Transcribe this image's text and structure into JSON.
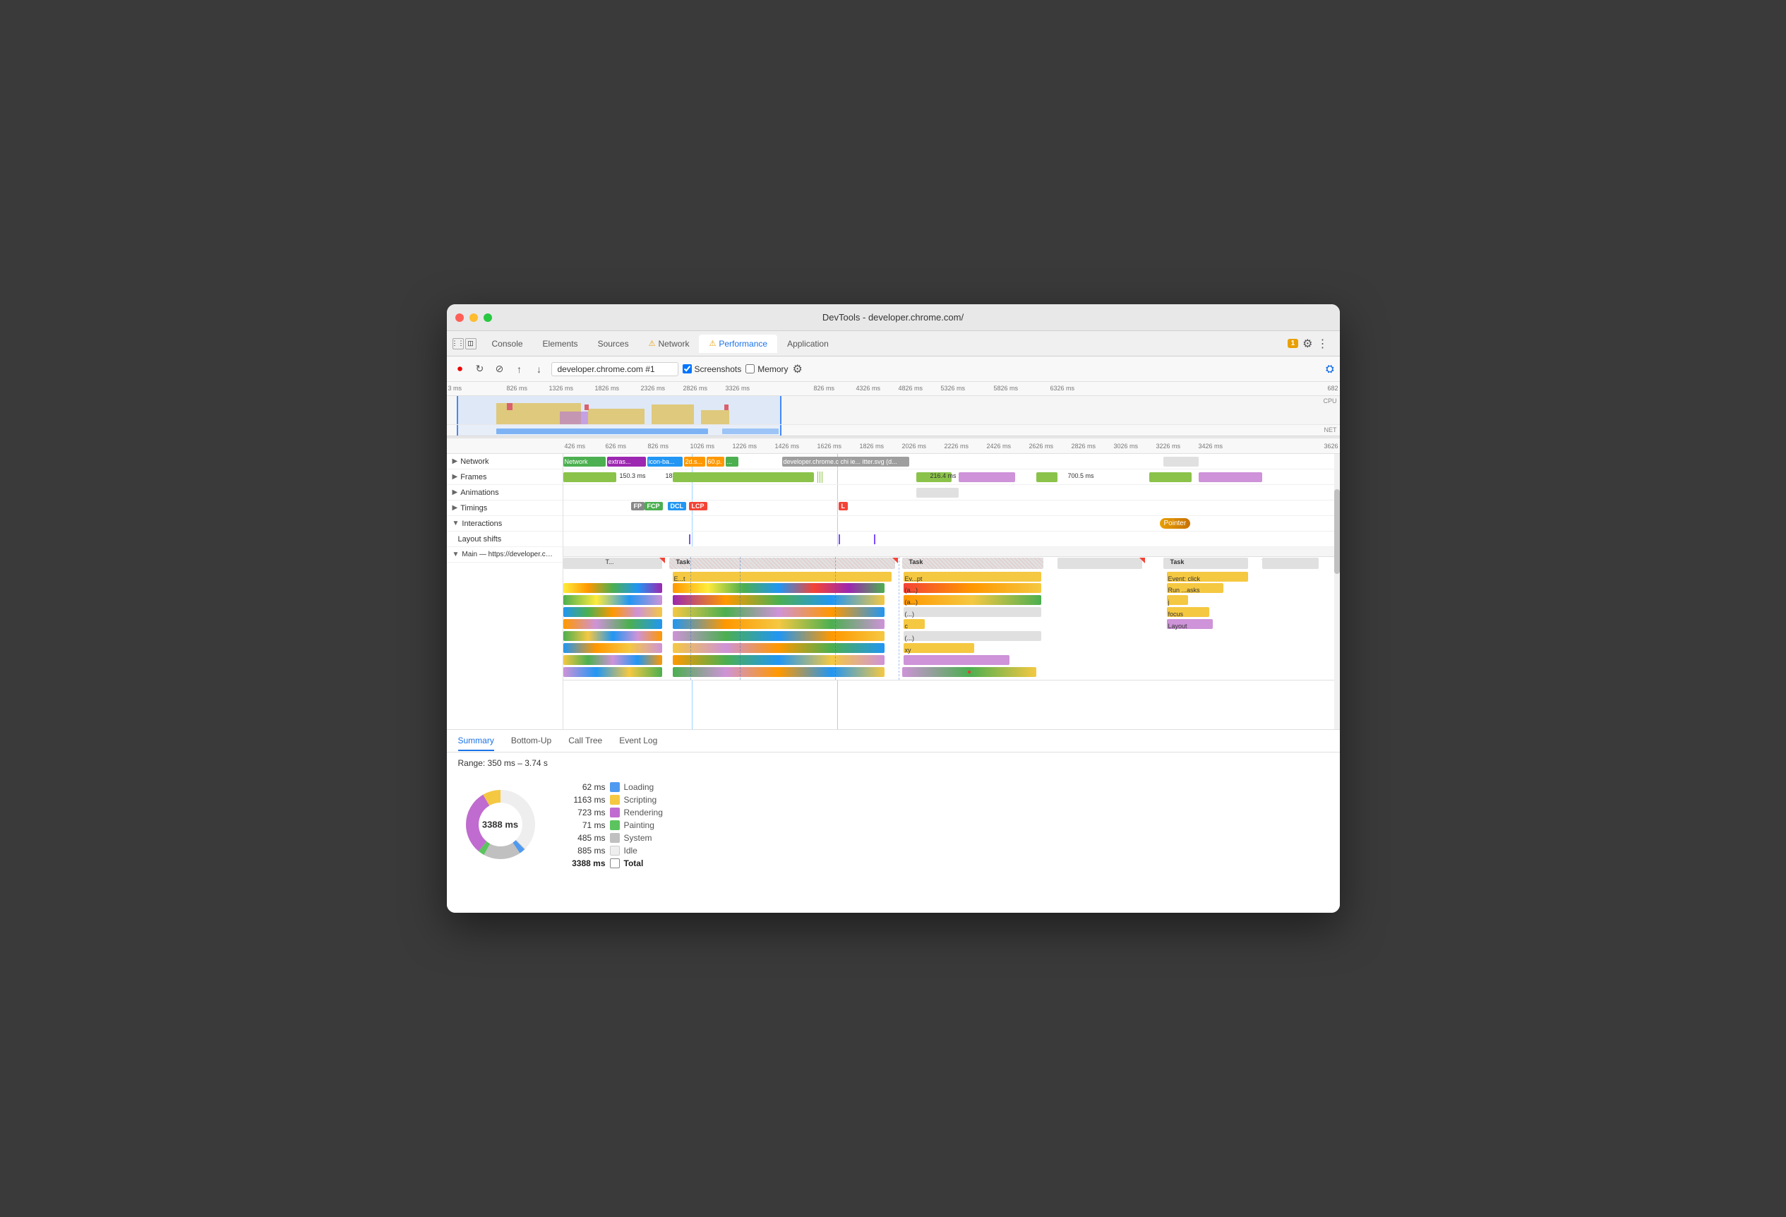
{
  "window": {
    "title": "DevTools - developer.chrome.com/"
  },
  "tabs": [
    {
      "id": "console",
      "label": "Console",
      "active": false,
      "warn": false
    },
    {
      "id": "elements",
      "label": "Elements",
      "active": false,
      "warn": false
    },
    {
      "id": "sources",
      "label": "Sources",
      "active": false,
      "warn": false
    },
    {
      "id": "network",
      "label": "Network",
      "active": false,
      "warn": true
    },
    {
      "id": "performance",
      "label": "Performance",
      "active": true,
      "warn": true
    },
    {
      "id": "application",
      "label": "Application",
      "active": false,
      "warn": false
    }
  ],
  "toolbar": {
    "url": "developer.chrome.com #1",
    "screenshots_label": "Screenshots",
    "memory_label": "Memory"
  },
  "ruler": {
    "ticks": [
      "3 ms",
      "426 ms",
      "626 ms",
      "826 ms",
      "1026 ms",
      "1226 ms",
      "1426 ms",
      "1626 ms",
      "1826 ms",
      "2026 ms",
      "2226 ms",
      "2426 ms",
      "2626 ms",
      "2826 ms",
      "3026 ms",
      "3226 ms",
      "3426 ms",
      "3626"
    ]
  },
  "overview_ruler": {
    "ticks": [
      "826 ms",
      "1326 ms",
      "1826 ms",
      "2326 ms",
      "2826 ms",
      "3326 ms",
      "826 ms",
      "4326 ms",
      "4826 ms",
      "5326 ms",
      "5826 ms",
      "6326 ms",
      "682"
    ]
  },
  "left_panel": {
    "rows": [
      {
        "id": "network",
        "label": "Network",
        "indent": 0,
        "has_arrow": true,
        "expanded": true
      },
      {
        "id": "frames",
        "label": "Frames",
        "indent": 0,
        "has_arrow": true,
        "expanded": false
      },
      {
        "id": "animations",
        "label": "Animations",
        "indent": 0,
        "has_arrow": true,
        "expanded": false
      },
      {
        "id": "timings",
        "label": "Timings",
        "indent": 0,
        "has_arrow": true,
        "expanded": false
      },
      {
        "id": "interactions",
        "label": "Interactions",
        "indent": 0,
        "has_arrow": true,
        "expanded": true
      },
      {
        "id": "layout_shifts",
        "label": "Layout shifts",
        "indent": 0,
        "has_arrow": false,
        "expanded": false
      },
      {
        "id": "main",
        "label": "Main — https://developer.chrome.com/",
        "indent": 0,
        "has_arrow": true,
        "expanded": true
      }
    ]
  },
  "bottom_tabs": {
    "tabs": [
      {
        "id": "summary",
        "label": "Summary",
        "active": true
      },
      {
        "id": "bottom-up",
        "label": "Bottom-Up",
        "active": false
      },
      {
        "id": "call-tree",
        "label": "Call Tree",
        "active": false
      },
      {
        "id": "event-log",
        "label": "Event Log",
        "active": false
      }
    ]
  },
  "summary": {
    "range": "Range: 350 ms – 3.74 s",
    "total_ms": "3388 ms",
    "items": [
      {
        "id": "loading",
        "value": "62 ms",
        "label": "Loading",
        "color": "#4e9af1"
      },
      {
        "id": "scripting",
        "value": "1163 ms",
        "label": "Scripting",
        "color": "#f5c842"
      },
      {
        "id": "rendering",
        "value": "723 ms",
        "label": "Rendering",
        "color": "#c06bcf"
      },
      {
        "id": "painting",
        "value": "71 ms",
        "label": "Painting",
        "color": "#5bc45e"
      },
      {
        "id": "system",
        "value": "485 ms",
        "label": "System",
        "color": "#c0c0c0"
      },
      {
        "id": "idle",
        "value": "885 ms",
        "label": "Idle",
        "color": "#eeeeee"
      },
      {
        "id": "total",
        "value": "3388 ms",
        "label": "Total",
        "color": "#ffffff"
      }
    ]
  }
}
